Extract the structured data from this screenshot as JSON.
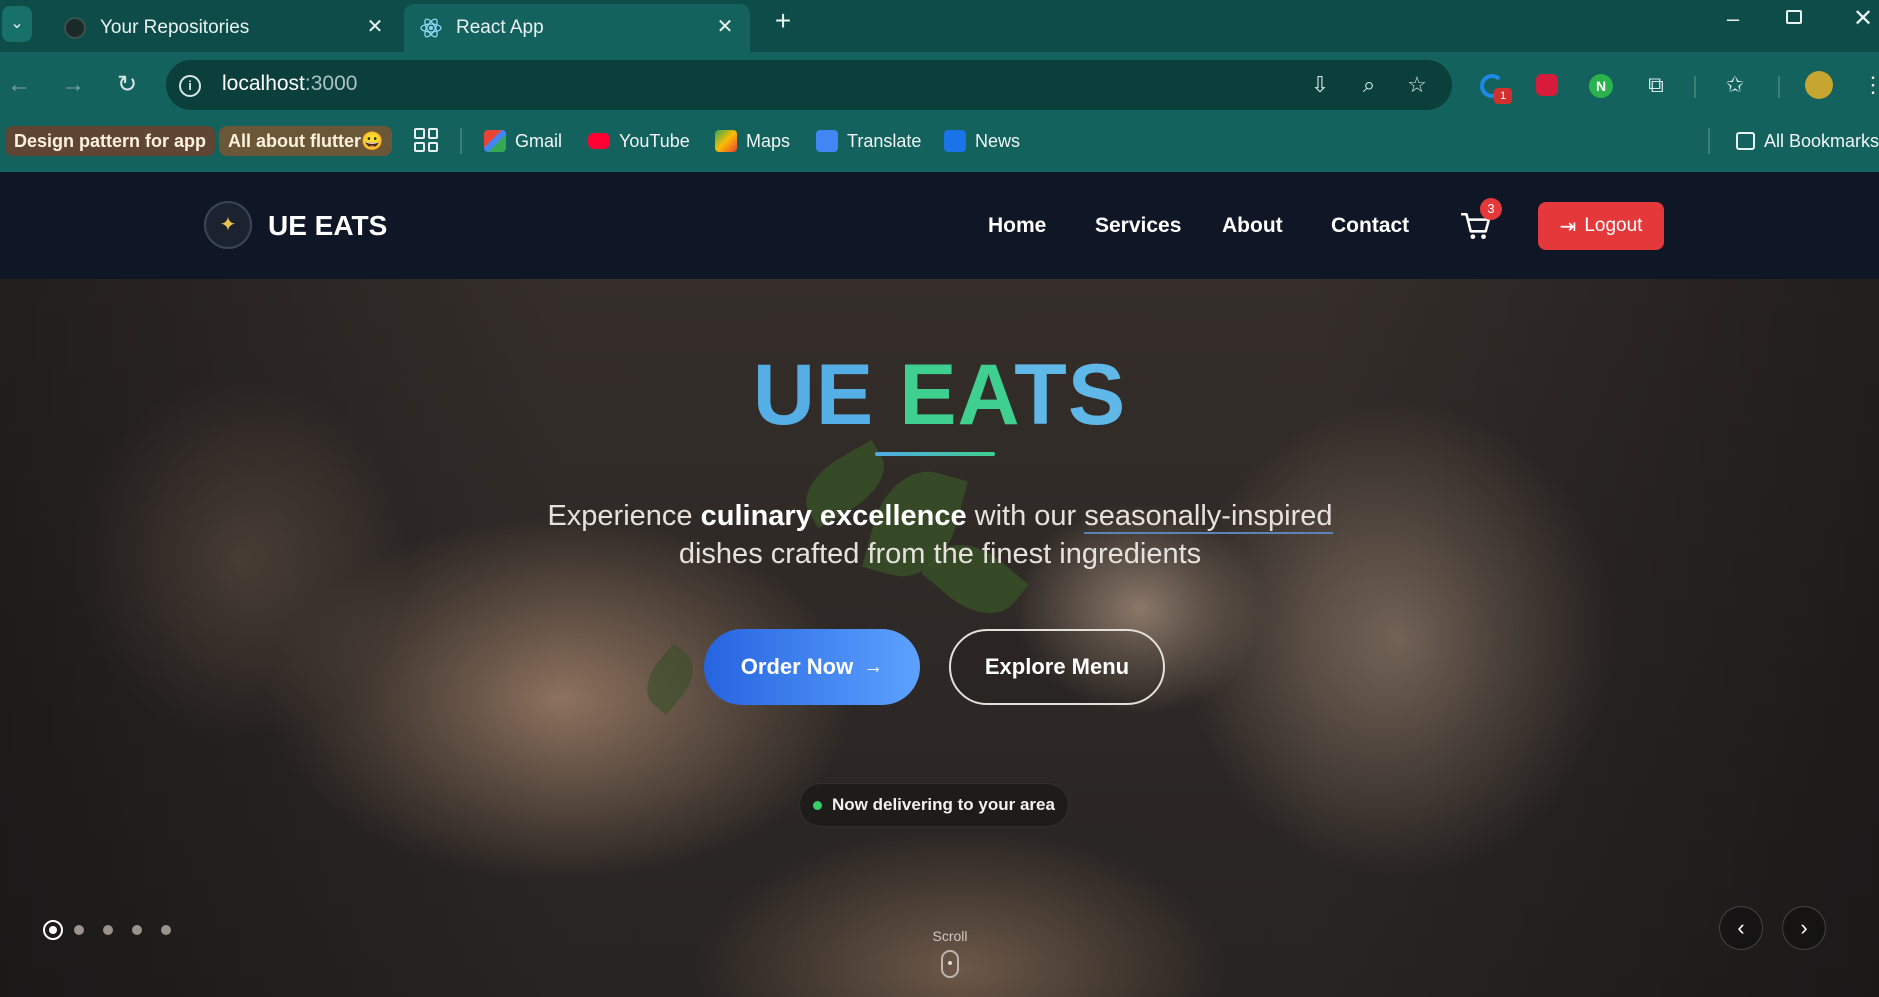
{
  "browser": {
    "tabs": [
      {
        "title": "Your Repositories"
      },
      {
        "title": "React App"
      }
    ],
    "url_host": "localhost",
    "url_port": ":3000",
    "bookmarks": {
      "chip1": "Design pattern for app",
      "chip2": "All about flutter😀",
      "gmail": "Gmail",
      "youtube": "YouTube",
      "maps": "Maps",
      "translate": "Translate",
      "news": "News",
      "all": "All Bookmarks"
    },
    "extension_badge": "1"
  },
  "site": {
    "brand": "UE EATS",
    "nav": {
      "home": "Home",
      "services": "Services",
      "about": "About",
      "contact": "Contact"
    },
    "cart_count": "3",
    "logout": "Logout",
    "hero": {
      "title_word1": "UE",
      "title_word2": "EA",
      "title_word3": "TS",
      "sub_1": "Experience ",
      "sub_bold": "culinary excellence",
      "sub_2": " with our ",
      "sub_underline": "seasonally-inspired",
      "sub_3": "dishes crafted from the finest ingredients",
      "order_btn": "Order Now",
      "explore_btn": "Explore Menu",
      "badge": "Now delivering to your area",
      "scroll": "Scroll"
    },
    "slides_total": 5,
    "slide_active": 1
  },
  "colors": {
    "accent_blue": "#2664e0",
    "logout_red": "#e5383b",
    "title_green": "#3fcf8e",
    "title_blue": "#56aee6",
    "delivery_green": "#37d066"
  }
}
